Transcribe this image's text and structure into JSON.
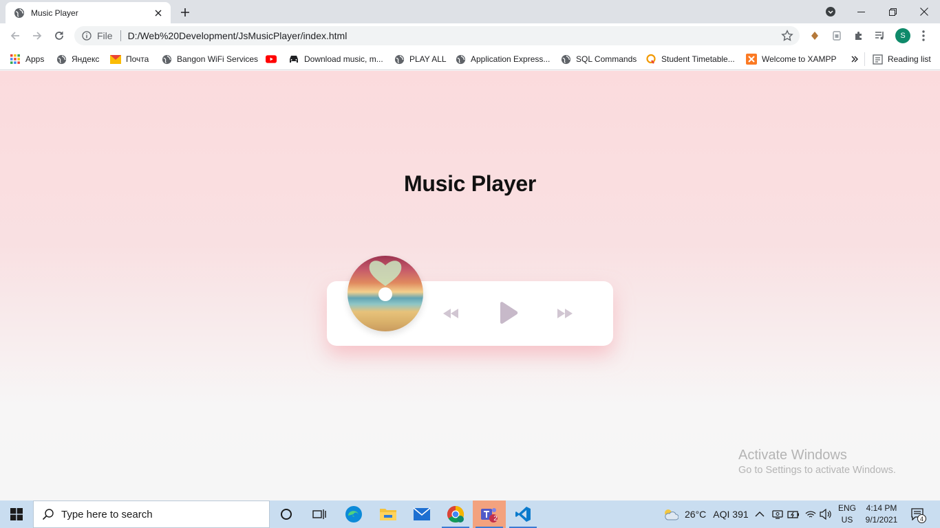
{
  "browser": {
    "tab_title": "Music Player",
    "scheme_label": "File",
    "url": "D:/Web%20Development/JsMusicPlayer/index.html",
    "profile_initial": "S"
  },
  "bookmarks": [
    {
      "label": "Apps",
      "icon": "apps-grid-icon"
    },
    {
      "label": "Яндекс",
      "icon": "globe-icon"
    },
    {
      "label": "Почта",
      "icon": "mail-icon"
    },
    {
      "label": "Bangon WiFi Services",
      "icon": "globe-icon"
    },
    {
      "label": "",
      "icon": "youtube-icon"
    },
    {
      "label": "Download music, m...",
      "icon": "car-icon"
    },
    {
      "label": "PLAY ALL",
      "icon": "globe-icon"
    },
    {
      "label": "Application Express...",
      "icon": "globe-icon"
    },
    {
      "label": "SQL Commands",
      "icon": "globe-icon"
    },
    {
      "label": "Student Timetable...",
      "icon": "q-icon"
    },
    {
      "label": "Welcome to XAMPP",
      "icon": "xampp-icon"
    }
  ],
  "reading_list_label": "Reading list",
  "page": {
    "title": "Music Player",
    "watermark_title": "Activate Windows",
    "watermark_sub": "Go to Settings to activate Windows."
  },
  "taskbar": {
    "search_placeholder": "Type here to search",
    "weather": "26°C",
    "aqi": "AQI 391",
    "lang_top": "ENG",
    "lang_bottom": "US",
    "time": "4:14 PM",
    "date": "9/1/2021",
    "teams_badge": "2",
    "notif_count": "4"
  },
  "colors": {
    "page_top": "#fbdbdd",
    "page_bottom": "#f6f6f6",
    "control_icon": "#cfc3cf",
    "play_icon": "#c6b8c8"
  }
}
